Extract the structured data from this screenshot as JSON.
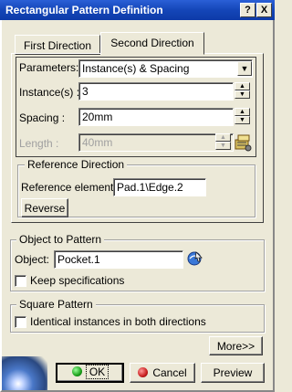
{
  "window": {
    "title": "Rectangular Pattern Definition",
    "help_label": "?",
    "close_label": "X"
  },
  "tabs": [
    {
      "label": "First Direction"
    },
    {
      "label": "Second Direction",
      "selected": true
    }
  ],
  "parameters": {
    "label": "Parameters:",
    "value": "Instance(s) & Spacing"
  },
  "instances": {
    "label": "Instance(s) :",
    "value": "3"
  },
  "spacing": {
    "label": "Spacing :",
    "value": "20mm"
  },
  "length": {
    "label": "Length :",
    "value": "40mm"
  },
  "reference_direction": {
    "title": "Reference Direction",
    "element_label": "Reference element:",
    "element_value": "Pad.1\\Edge.2",
    "reverse_label": "Reverse"
  },
  "object_to_pattern": {
    "title": "Object to Pattern",
    "object_label": "Object:",
    "object_value": "Pocket.1",
    "keep_specs_label": "Keep specifications",
    "keep_specs_checked": false
  },
  "square_pattern": {
    "title": "Square Pattern",
    "identical_label": "Identical instances in both directions",
    "identical_checked": false
  },
  "buttons": {
    "more": "More>>",
    "ok": "OK",
    "cancel": "Cancel",
    "preview": "Preview"
  },
  "colors": {
    "title_bar": "#1446b8",
    "dialog_bg": "#ece9d8",
    "ok_icon": "#1aa01a",
    "cancel_icon": "#c81e1e"
  },
  "icons": [
    "help-icon",
    "close-icon",
    "dropdown-arrow-icon",
    "spin-up-icon",
    "spin-down-icon",
    "measure-tool-icon",
    "selection-icon",
    "ok-dot-icon",
    "cancel-dot-icon"
  ]
}
